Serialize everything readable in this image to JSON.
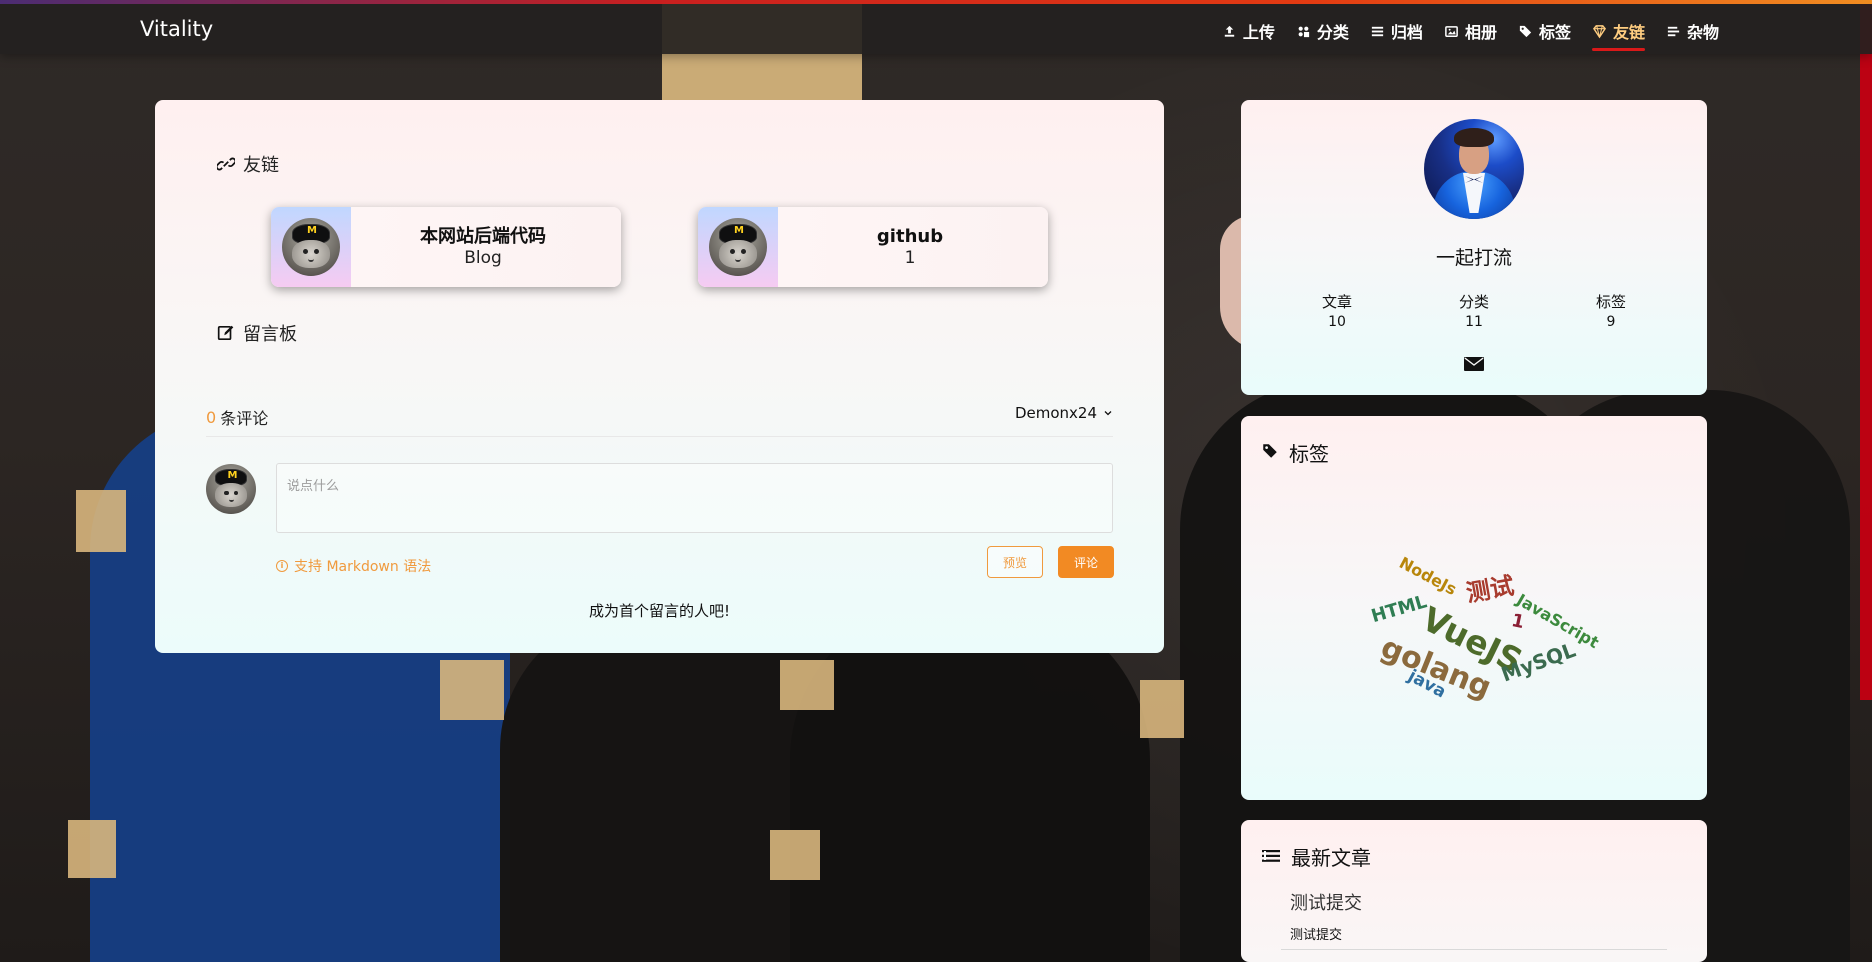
{
  "brand": "Vitality",
  "nav": [
    {
      "label": "上传",
      "icon": "upload-icon",
      "active": false
    },
    {
      "label": "分类",
      "icon": "categories-icon",
      "active": false
    },
    {
      "label": "归档",
      "icon": "archive-icon",
      "active": false
    },
    {
      "label": "相册",
      "icon": "gallery-icon",
      "active": false
    },
    {
      "label": "标签",
      "icon": "tag-icon",
      "active": false
    },
    {
      "label": "友链",
      "icon": "friend-links-icon",
      "active": true
    },
    {
      "label": "杂物",
      "icon": "misc-icon",
      "active": false
    }
  ],
  "main": {
    "friend_title": "友链",
    "board_title": "留言板",
    "friends": [
      {
        "name": "本网站后端代码",
        "desc": "Blog"
      },
      {
        "name": "github",
        "desc": "1"
      }
    ],
    "comments": {
      "count": "0",
      "count_label": "条评论",
      "user": "Demonx24",
      "placeholder": "说点什么",
      "markdown_hint": "支持 Markdown 语法",
      "preview_label": "预览",
      "submit_label": "评论",
      "empty_text": "成为首个留言的人吧!"
    }
  },
  "profile": {
    "name": "一起打流",
    "stats": [
      {
        "label": "文章",
        "value": "10"
      },
      {
        "label": "分类",
        "value": "11"
      },
      {
        "label": "标签",
        "value": "9"
      }
    ]
  },
  "tags": {
    "title": "标签",
    "words": [
      {
        "text": "NodeJs",
        "color": "#b8860b"
      },
      {
        "text": "测试",
        "color": "#a83b2e"
      },
      {
        "text": "JavaScript",
        "color": "#3c8a3d"
      },
      {
        "text": "HTML",
        "color": "#2f7d53"
      },
      {
        "text": "VueJS",
        "color": "#4d6b2b"
      },
      {
        "text": "1",
        "color": "#8b1f35"
      },
      {
        "text": "golang",
        "color": "#8b6a3d"
      },
      {
        "text": "MySQL",
        "color": "#3b6b4f"
      },
      {
        "text": "java",
        "color": "#2f6fa0"
      }
    ]
  },
  "latest": {
    "title": "最新文章",
    "item_title": "测试提交",
    "item_subtitle": "测试提交"
  }
}
